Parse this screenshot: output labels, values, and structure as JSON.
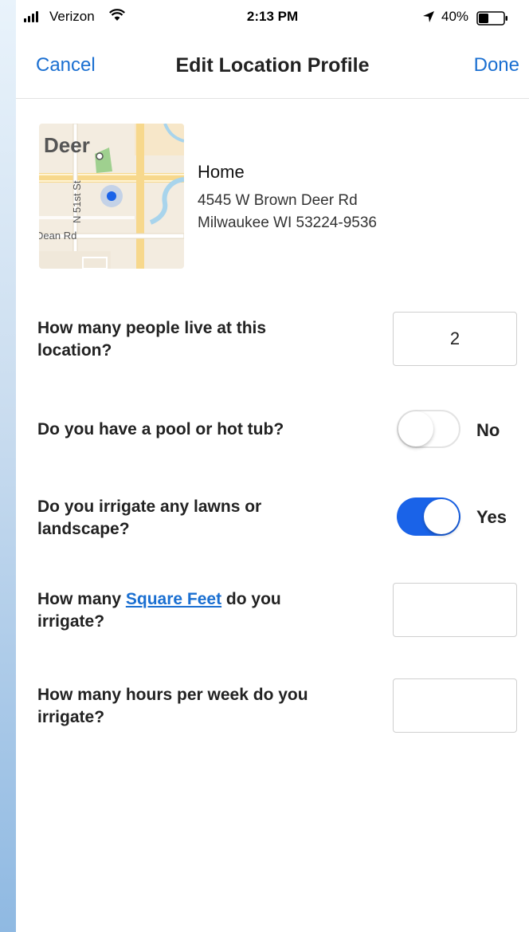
{
  "status_bar": {
    "carrier": "Verizon",
    "time": "2:13 PM",
    "battery_percent": "40%",
    "battery_level": 0.4
  },
  "nav": {
    "cancel_label": "Cancel",
    "title": "Edit Location Profile",
    "done_label": "Done"
  },
  "location": {
    "name": "Home",
    "address_line1": "4545 W Brown Deer Rd",
    "address_line2": "Milwaukee WI 53224-9536",
    "map_labels": {
      "area": "Deer",
      "street_vertical": "N 51st St",
      "street_horizontal": "Dean Rd"
    }
  },
  "questions": {
    "people": {
      "label": "How many people live at this location?",
      "value": "2"
    },
    "pool": {
      "label": "Do you have a pool or hot tub?",
      "state_label": "No",
      "enabled": false
    },
    "irrigate": {
      "label": "Do you irrigate any lawns or landscape?",
      "state_label": "Yes",
      "enabled": true
    },
    "square_feet": {
      "label_prefix": "How many ",
      "label_link": "Square Feet",
      "label_suffix": " do you irrigate?",
      "value": ""
    },
    "hours": {
      "label": "How many hours per week do you irrigate?",
      "value": ""
    }
  },
  "colors": {
    "accent": "#1a6fd1",
    "toggle_on": "#1a63e8"
  }
}
